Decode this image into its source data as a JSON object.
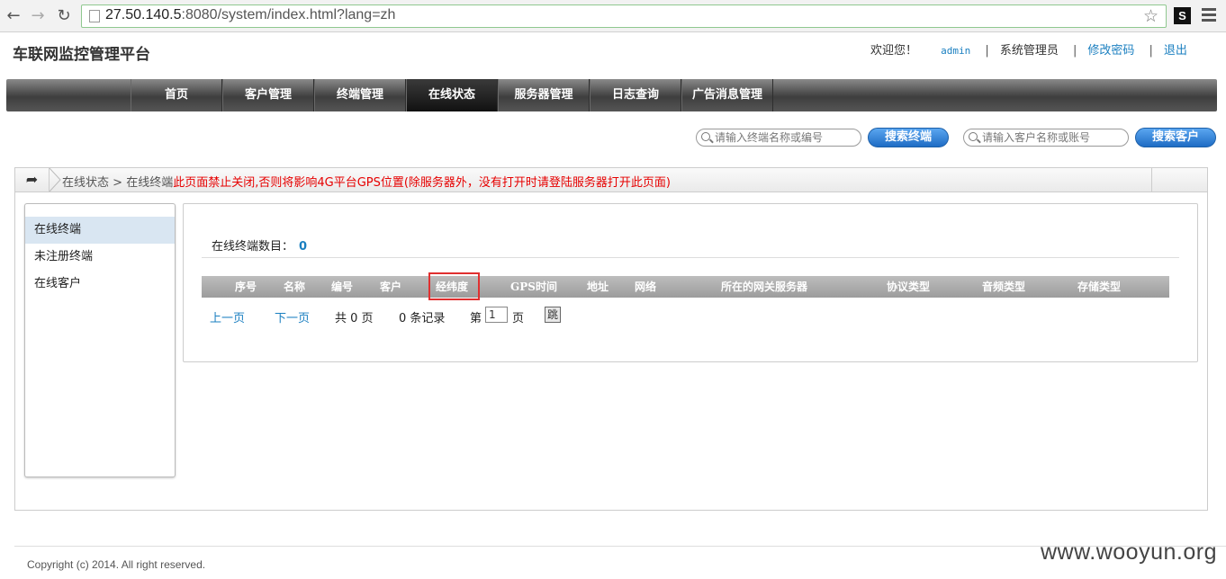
{
  "browser": {
    "url_host": "27.50.140.5",
    "url_rest": ":8080/system/index.html?lang=zh"
  },
  "header": {
    "site_title": "车联网监控管理平台",
    "welcome": "欢迎您！",
    "username": "admin",
    "role": "系统管理员",
    "change_password": "修改密码",
    "logout": "退出",
    "separator": "|"
  },
  "nav": {
    "items": [
      {
        "label": "首页"
      },
      {
        "label": "客户管理"
      },
      {
        "label": "终端管理"
      },
      {
        "label": "在线状态"
      },
      {
        "label": "服务器管理"
      },
      {
        "label": "日志查询"
      },
      {
        "label": "广告消息管理"
      }
    ],
    "active_index": 3
  },
  "search": {
    "terminal_placeholder": "请输入终端名称或编号",
    "terminal_button": "搜索终端",
    "customer_placeholder": "请输入客户名称或账号",
    "customer_button": "搜索客户"
  },
  "breadcrumb": {
    "level1": "在线状态",
    "sep": ">",
    "level2": "在线终端",
    "warning": "此页面禁止关闭,否则将影响4G平台GPS位置(除服务器外，没有打开时请登陆服务器打开此页面)"
  },
  "sidebar": {
    "items": [
      {
        "label": "在线终端"
      },
      {
        "label": "未注册终端"
      },
      {
        "label": "在线客户"
      }
    ]
  },
  "panel": {
    "count_label": "在线终端数目：",
    "count_value": "0",
    "columns": [
      "序号",
      "名称",
      "编号",
      "客户",
      "经纬度",
      "GPS时间",
      "地址",
      "网络",
      "所在的网关服务器",
      "协议类型",
      "音频类型",
      "存储类型"
    ]
  },
  "pager": {
    "prev": "上一页",
    "next": "下一页",
    "total_pages": "共 0 页",
    "total_records": "0 条记录",
    "page_prefix": "第",
    "page_value": "1",
    "page_suffix": "页",
    "jump": "跳"
  },
  "footer": {
    "copyright": "Copyright (c) 2014. All right reserved.",
    "watermark": "www.wooyun.org"
  }
}
